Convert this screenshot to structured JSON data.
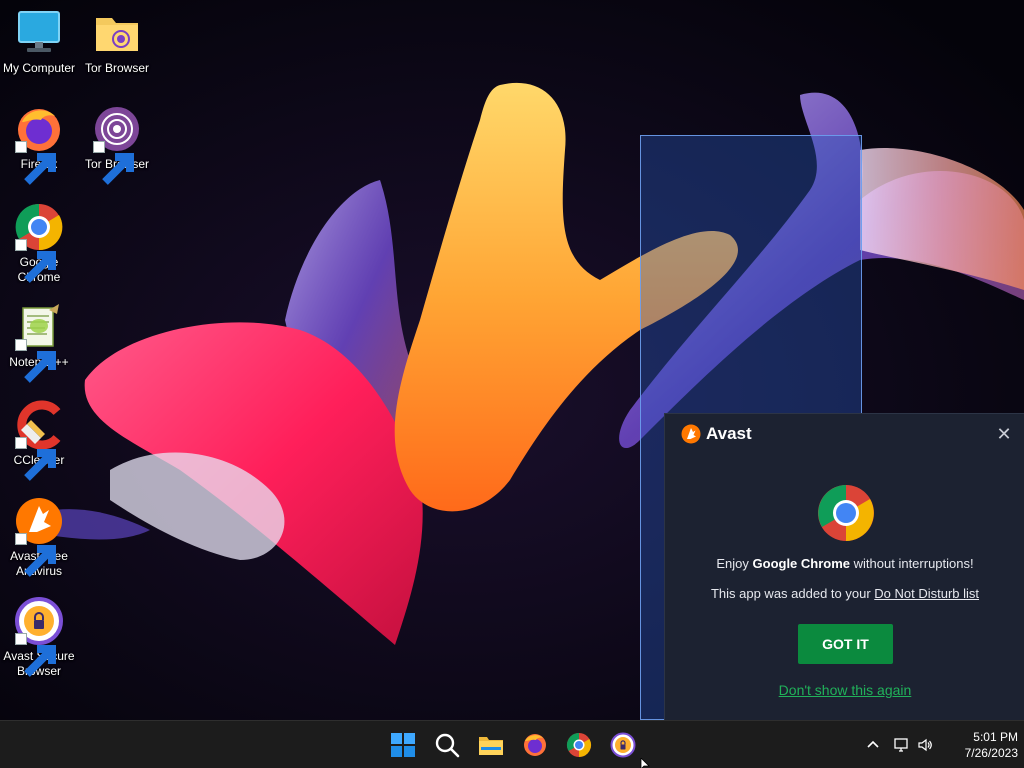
{
  "desktop": {
    "icons": [
      {
        "label": "My Computer",
        "icon": "monitor-icon"
      },
      {
        "label": "Tor Browser",
        "icon": "folder-icon"
      },
      {
        "label": "Firefox",
        "icon": "firefox-icon"
      },
      {
        "label": "Tor Browser",
        "icon": "tor-browser-icon"
      },
      {
        "label": "Google Chrome",
        "icon": "chrome-icon"
      },
      {
        "label": "Notepad++",
        "icon": "notepad-plus-plus-icon"
      },
      {
        "label": "CCleaner",
        "icon": "ccleaner-icon"
      },
      {
        "label": "Avast Free Antivirus",
        "icon": "avast-icon"
      },
      {
        "label": "Avast Secure Browser",
        "icon": "avast-secure-browser-icon"
      }
    ]
  },
  "popup": {
    "brand": "Avast",
    "close_icon": "close-icon",
    "app_icon": "chrome-icon",
    "msg1_prefix": "Enjoy ",
    "msg1_app": "Google Chrome",
    "msg1_suffix": " without interruptions!",
    "msg2_prefix": "This app was added to your ",
    "msg2_link": "Do Not Disturb list",
    "got_it_label": "GOT IT",
    "dont_show_label": "Don't show this again",
    "colors": {
      "background": "#1c2231",
      "button": "#0b8a3e",
      "link": "#21b25a",
      "brand_orange": "#ff7800"
    }
  },
  "taskbar": {
    "pinned": [
      {
        "name": "start-button",
        "icon": "windows-logo-icon"
      },
      {
        "name": "search-button",
        "icon": "search-icon"
      },
      {
        "name": "file-explorer-button",
        "icon": "folder-icon"
      },
      {
        "name": "firefox-taskbar-button",
        "icon": "firefox-icon"
      },
      {
        "name": "chrome-taskbar-button",
        "icon": "chrome-icon"
      },
      {
        "name": "avast-browser-taskbar-button",
        "icon": "avast-secure-browser-icon"
      }
    ],
    "tray": {
      "chevron_icon": "chevron-up-icon",
      "network_icon": "network-icon",
      "volume_icon": "volume-icon"
    },
    "clock": {
      "time": "5:01 PM",
      "date": "7/26/2023"
    }
  }
}
